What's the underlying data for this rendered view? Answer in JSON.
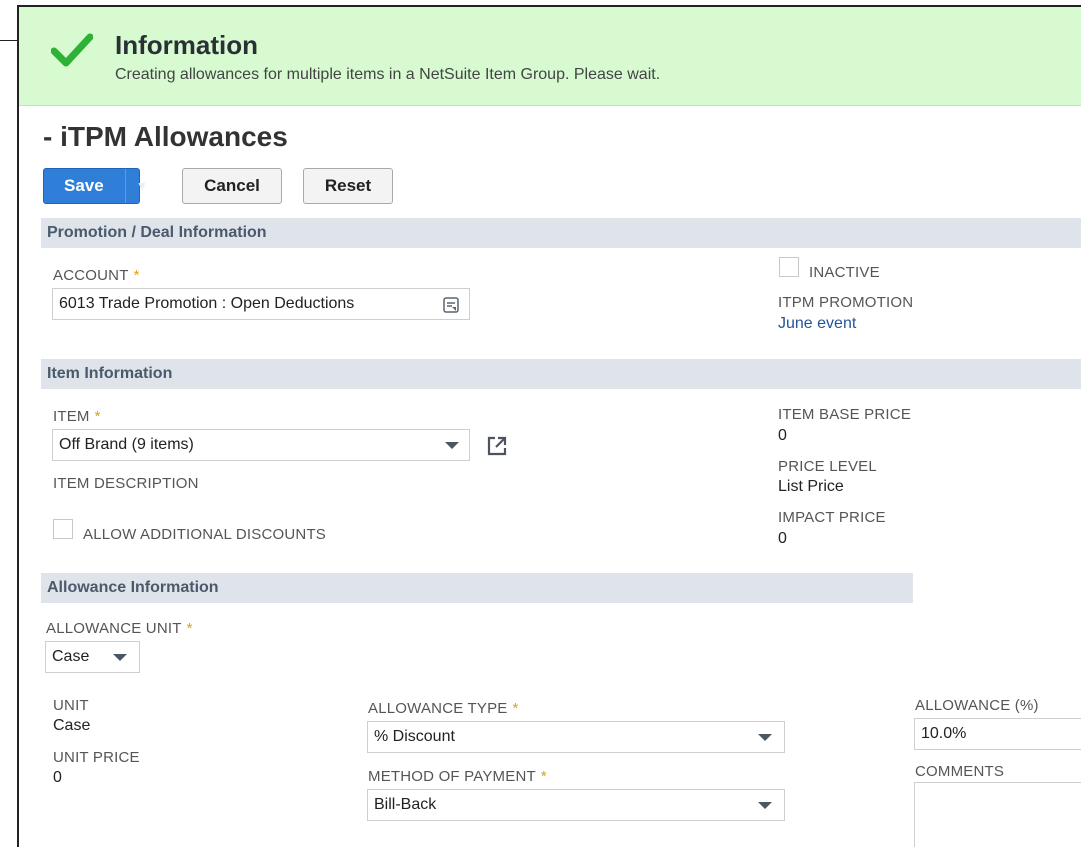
{
  "banner": {
    "title": "Information",
    "message": "Creating allowances for multiple items in a NetSuite Item Group. Please wait."
  },
  "page": {
    "title": "- iTPM Allowances"
  },
  "toolbar": {
    "save_label": "Save",
    "cancel_label": "Cancel",
    "reset_label": "Reset"
  },
  "sections": {
    "promotion": "Promotion / Deal Information",
    "item": "Item Information",
    "allowance": "Allowance Information"
  },
  "promotion": {
    "account_label": "ACCOUNT",
    "account_value": "6013 Trade Promotion : Open Deductions",
    "inactive_label": "INACTIVE",
    "itpm_promotion_label": "ITPM PROMOTION",
    "itpm_promotion_value": "June event"
  },
  "item": {
    "item_label": "ITEM",
    "item_value": "Off Brand (9 items)",
    "item_description_label": "ITEM DESCRIPTION",
    "allow_additional_discounts_label": "ALLOW ADDITIONAL DISCOUNTS",
    "item_base_price_label": "ITEM BASE PRICE",
    "item_base_price_value": "0",
    "price_level_label": "PRICE LEVEL",
    "price_level_value": "List Price",
    "impact_price_label": "IMPACT PRICE",
    "impact_price_value": "0"
  },
  "allowance": {
    "allowance_unit_label": "ALLOWANCE UNIT",
    "allowance_unit_value": "Case",
    "unit_label": "UNIT",
    "unit_value": "Case",
    "unit_price_label": "UNIT PRICE",
    "unit_price_value": "0",
    "allowance_type_label": "ALLOWANCE TYPE",
    "allowance_type_value": "% Discount",
    "method_of_payment_label": "METHOD OF PAYMENT",
    "method_of_payment_value": "Bill-Back",
    "allowance_pct_label": "ALLOWANCE (%)",
    "allowance_pct_value": "10.0%",
    "comments_label": "COMMENTS"
  },
  "colors": {
    "banner_bg": "#d7fad1",
    "check_green": "#2fb135",
    "save_blue": "#2f7fd8",
    "section_bg": "#dfe4eb",
    "link": "#255599",
    "required": "#e2a300"
  },
  "icons": {
    "banner": "checkmark-icon",
    "save_menu": "caret-down-icon",
    "account_picker": "list-picker-icon",
    "open_item": "open-external-icon"
  }
}
